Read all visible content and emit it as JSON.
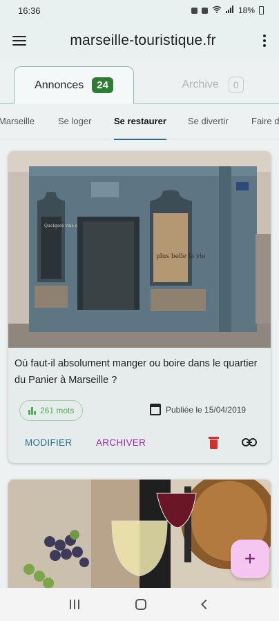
{
  "status_bar": {
    "time": "16:36",
    "battery": "18%"
  },
  "app_bar": {
    "title": "marseille-touristique.fr"
  },
  "tabs": [
    {
      "label": "Annonces",
      "count": "24"
    },
    {
      "label": "Archive",
      "count": "0"
    }
  ],
  "categories": [
    "Marseille",
    "Se loger",
    "Se restaurer",
    "Se divertir",
    "Faire d"
  ],
  "active_category": "Se restaurer",
  "card": {
    "title": "Où faut-il absolument manger ou boire dans le quartier du Panier à Marseille ?",
    "words": "261 mots",
    "published": "Publiée le 15/04/2019",
    "edit_label": "MODIFIER",
    "archive_label": "ARCHIVER",
    "photo_texts": {
      "window_left": "Quelques vins et délices",
      "window_right": "plus belle la vie"
    }
  },
  "fab_label": "+",
  "colors": {
    "accent_blue": "#2a6e85",
    "accent_purple": "#9c27b0",
    "green": "#2e7d32",
    "delete_red": "#d32f2f",
    "fab_bg": "#f4c6f0"
  }
}
